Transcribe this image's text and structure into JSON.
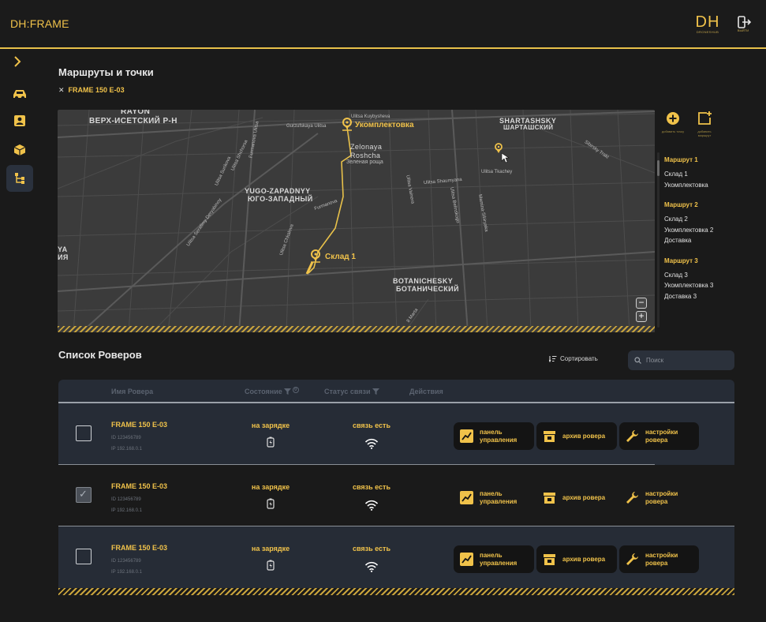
{
  "app": {
    "logo": "DH:FRAME",
    "brand_big": "DH",
    "brand_small": "DRONESHUB",
    "exit_label": "ВЫЙТИ"
  },
  "page": {
    "title": "Маршруты и точки",
    "filter_chip": "FRAME 150 E-03"
  },
  "map": {
    "districts": [
      "RAYON",
      "ВЕРХ-ИСЕТСКИЙ Р-Н",
      "SHARTASHSKY",
      "ШАРТАШСКИЙ",
      "YUGO-ZAPADNYY",
      "ЮГО-ЗАПАДНЫЙ",
      "BOTANICHESKY",
      "БОТАНИЧЕСКИЙ",
      "YA",
      "ИЯ"
    ],
    "neighborhood": [
      "Zelonaya",
      "Roshcha",
      "Зеленая роща"
    ],
    "streets": [
      "Gurzufskaya Ulitsa",
      "Ulitsa Kuybysheva",
      "Ulitsa Tkachey",
      "Sibirsky Trakt",
      "Ulitsa Surikova",
      "Ulitsa Shchorsa",
      "Ulitsa Vainera",
      "Ulitsa Belinskogo",
      "Mamina-Sibiryaka",
      "Ulitsa Shaumyana",
      "Ulitsa Chkalova",
      "Ulitsa Serafimy Deryabinoy",
      "8 Marta",
      "Furmanova",
      "Furmanova Ulitsa"
    ],
    "pins": [
      {
        "label": "Укомплектовка"
      },
      {
        "label": "Склад 1"
      },
      {
        "label": ""
      }
    ],
    "zoom_out": "−",
    "zoom_in": "+"
  },
  "tools": [
    {
      "caption": "добавить точку"
    },
    {
      "caption": "добавить маршрут"
    }
  ],
  "routes": [
    {
      "title": "Маршрут 1",
      "points": [
        "Склад 1",
        "Укомплектовка"
      ]
    },
    {
      "title": "Маршрут 2",
      "points": [
        "Склад 2",
        "Укомплектовка 2",
        "Доставка"
      ]
    },
    {
      "title": "Маршрут 3",
      "points": [
        "Склад 3",
        "Укомплектовка 3",
        "Доставка 3"
      ]
    }
  ],
  "list": {
    "title": "Список Роверов",
    "sort_label": "Сортировать",
    "search_placeholder": "Поиск",
    "columns": {
      "name": "Имя Ровера",
      "state": "Состояние",
      "state_badge": "0",
      "link": "Статус связи",
      "actions": "Действия"
    },
    "rows": [
      {
        "name": "FRAME 150 E-03",
        "id": "ID  123456789",
        "ip": "IP  192.168.0.1",
        "state": "на зарядке",
        "link": "связь есть",
        "checked": false
      },
      {
        "name": "FRAME 150 E-03",
        "id": "ID  123456789",
        "ip": "IP  192.168.0.1",
        "state": "на зарядке",
        "link": "связь есть",
        "checked": true
      },
      {
        "name": "FRAME 150 E-03",
        "id": "ID  123456789",
        "ip": "IP  192.168.0.1",
        "state": "на зарядке",
        "link": "связь есть",
        "checked": false
      }
    ],
    "actions": {
      "panel": "панель\nуправления",
      "archive": "архив ровера",
      "settings": "настройки\nровера"
    }
  },
  "colors": {
    "accent": "#f0c24a",
    "row_dark": "#262c36",
    "bg": "#1a1a1a",
    "map": "#3b3b3b"
  }
}
